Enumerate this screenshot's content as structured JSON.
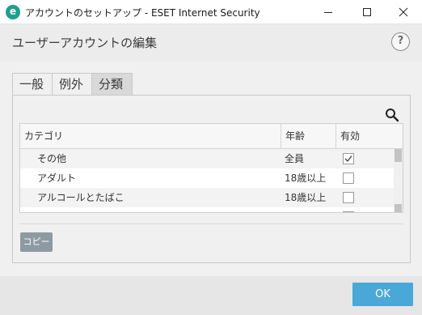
{
  "window": {
    "title": "アカウントのセットアップ - ESET Internet Security",
    "logo_letter": "e"
  },
  "header": {
    "title": "ユーザーアカウントの編集",
    "help_label": "?"
  },
  "tabs": [
    {
      "label": "一般",
      "active": false
    },
    {
      "label": "例外",
      "active": false
    },
    {
      "label": "分類",
      "active": true
    }
  ],
  "table": {
    "columns": [
      "カテゴリ",
      "年齢",
      "有効"
    ],
    "rows": [
      {
        "category": "その他",
        "age": "全員",
        "enabled": true
      },
      {
        "category": "アダルト",
        "age": "18歳以上",
        "enabled": false
      },
      {
        "category": "アルコールとたばこ",
        "age": "18歳以上",
        "enabled": false
      }
    ]
  },
  "buttons": {
    "copy": "コピー",
    "ok": "OK"
  },
  "colors": {
    "accent": "#4aa8d8",
    "copy_button": "#8e9aa2",
    "logo": "#1f9e8e"
  }
}
